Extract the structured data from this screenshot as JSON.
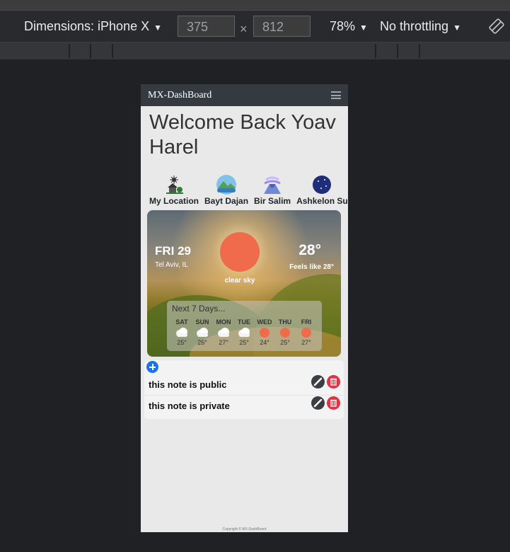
{
  "devtools": {
    "dimensions_label": "Dimensions: iPhone X",
    "width_value": "375",
    "times_sign": "×",
    "height_value": "812",
    "zoom": "78%",
    "throttling": "No throttling",
    "rotate_icon": "rotate-icon",
    "caret_icon": "caret-down-icon"
  },
  "app": {
    "brand": "MX-DashBoard",
    "menu_icon": "hamburger-icon",
    "welcome": "Welcome Back Yoav Harel",
    "locations": [
      {
        "label": "My Location",
        "icon": "location-house-icon"
      },
      {
        "label": "Bayt Dajan",
        "icon": "lake-icon"
      },
      {
        "label": "Bir Salim",
        "icon": "volcano-icon"
      },
      {
        "label": "Ashkelon Su",
        "icon": "night-icon"
      }
    ],
    "weather": {
      "day": "FRI 29",
      "city": "Tel Aviv, IL",
      "description": "clear sky",
      "temp": "28°",
      "feels_like": "Feels like 28°",
      "forecast_title": "Next 7 Days...",
      "forecast": [
        {
          "day": "SAT",
          "temp": "25°",
          "icon": "cloudy-icon"
        },
        {
          "day": "SUN",
          "temp": "26°",
          "icon": "cloudy-icon"
        },
        {
          "day": "MON",
          "temp": "27°",
          "icon": "cloudy-icon"
        },
        {
          "day": "TUE",
          "temp": "25°",
          "icon": "cloudy-icon"
        },
        {
          "day": "WED",
          "temp": "24°",
          "icon": "sun-icon"
        },
        {
          "day": "THU",
          "temp": "25°",
          "icon": "sun-icon"
        },
        {
          "day": "FRI",
          "temp": "27°",
          "icon": "sun-icon"
        }
      ]
    },
    "notes": [
      {
        "text": "this note is public"
      },
      {
        "text": "this note is private"
      }
    ],
    "footer": "Copyright © MX-DashBoard",
    "colors": {
      "navbar": "#343a40",
      "sun": "#ef6b4b",
      "add_button": "#1a73e8",
      "delete_button": "#dc3545",
      "edit_button": "#3a3f44"
    }
  }
}
